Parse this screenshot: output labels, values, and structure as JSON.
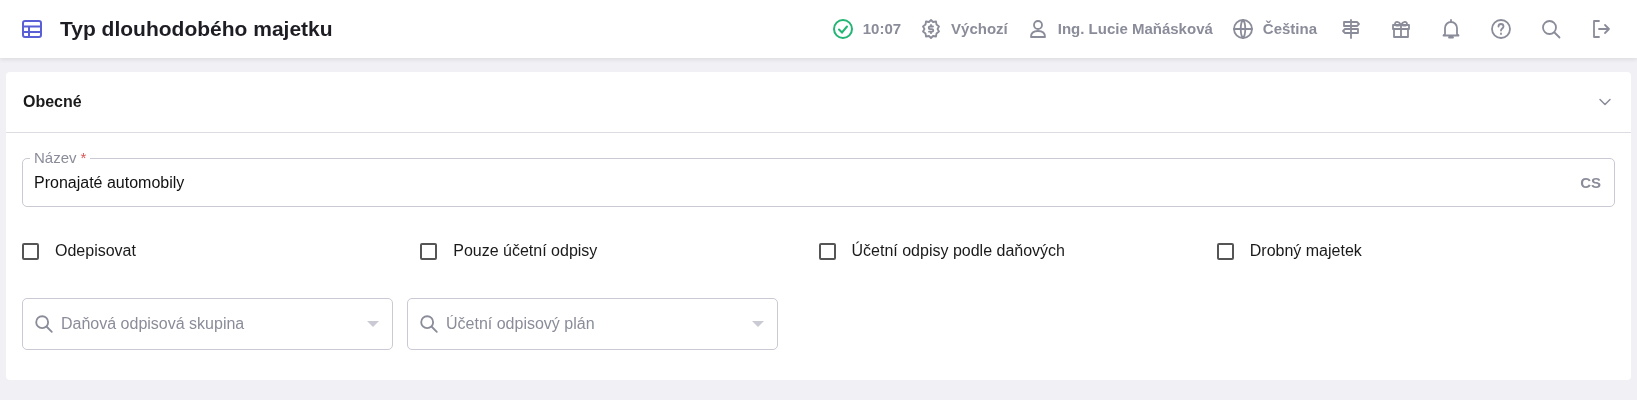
{
  "header": {
    "title": "Typ dlouhodobého majetku",
    "status": {
      "ok": true,
      "time": "10:07"
    },
    "currency": "Výchozí",
    "user": "Ing. Lucie Maňásková",
    "language": "Čeština",
    "tools": [
      {
        "kind": "signpost"
      },
      {
        "kind": "gift"
      },
      {
        "kind": "bell"
      },
      {
        "kind": "help"
      },
      {
        "kind": "search"
      },
      {
        "kind": "logout"
      }
    ]
  },
  "section": {
    "title": "Obecné",
    "expanded": true,
    "name_field": {
      "label": "Název",
      "required_mark": "*",
      "value": "Pronajaté automobily",
      "lang": "CS"
    },
    "checkboxes": [
      {
        "label": "Odepisovat",
        "checked": false
      },
      {
        "label": "Pouze účetní odpisy",
        "checked": false
      },
      {
        "label": "Účetní odpisy podle daňových",
        "checked": false
      },
      {
        "label": "Drobný majetek",
        "checked": false
      }
    ],
    "selects": [
      {
        "placeholder": "Daňová odpisová skupina"
      },
      {
        "placeholder": "Účetní odpisový plán"
      }
    ]
  }
}
